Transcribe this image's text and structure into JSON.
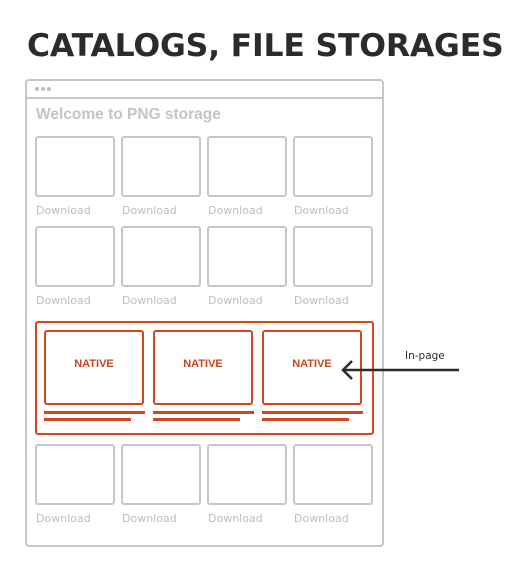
{
  "heading": "CATALOGS, FILE STORAGES",
  "window": {
    "titlebar_icon": "window-dots-icon",
    "welcome_text": "Welcome to PNG storage"
  },
  "tile_rows": [
    {
      "items": [
        {
          "label": "Download"
        },
        {
          "label": "Download"
        },
        {
          "label": "Download"
        },
        {
          "label": "Download"
        }
      ]
    },
    {
      "items": [
        {
          "label": "Download"
        },
        {
          "label": "Download"
        },
        {
          "label": "Download"
        },
        {
          "label": "Download"
        }
      ]
    },
    {
      "items": [
        {
          "label": "Download"
        },
        {
          "label": "Download"
        },
        {
          "label": "Download"
        },
        {
          "label": "Download"
        }
      ]
    }
  ],
  "native_block": {
    "cards": [
      {
        "label": "NATIVE"
      },
      {
        "label": "NATIVE"
      },
      {
        "label": "NATIVE"
      }
    ]
  },
  "annotation": {
    "label": "In-page",
    "icon": "arrow-left-icon"
  },
  "colors": {
    "heading": "#2b2b2b",
    "wireframe_gray": "#c6c6c6",
    "placeholder_text": "#bdbdbd",
    "native_accent": "#cf4620",
    "annotation": "#2b2b2b"
  }
}
